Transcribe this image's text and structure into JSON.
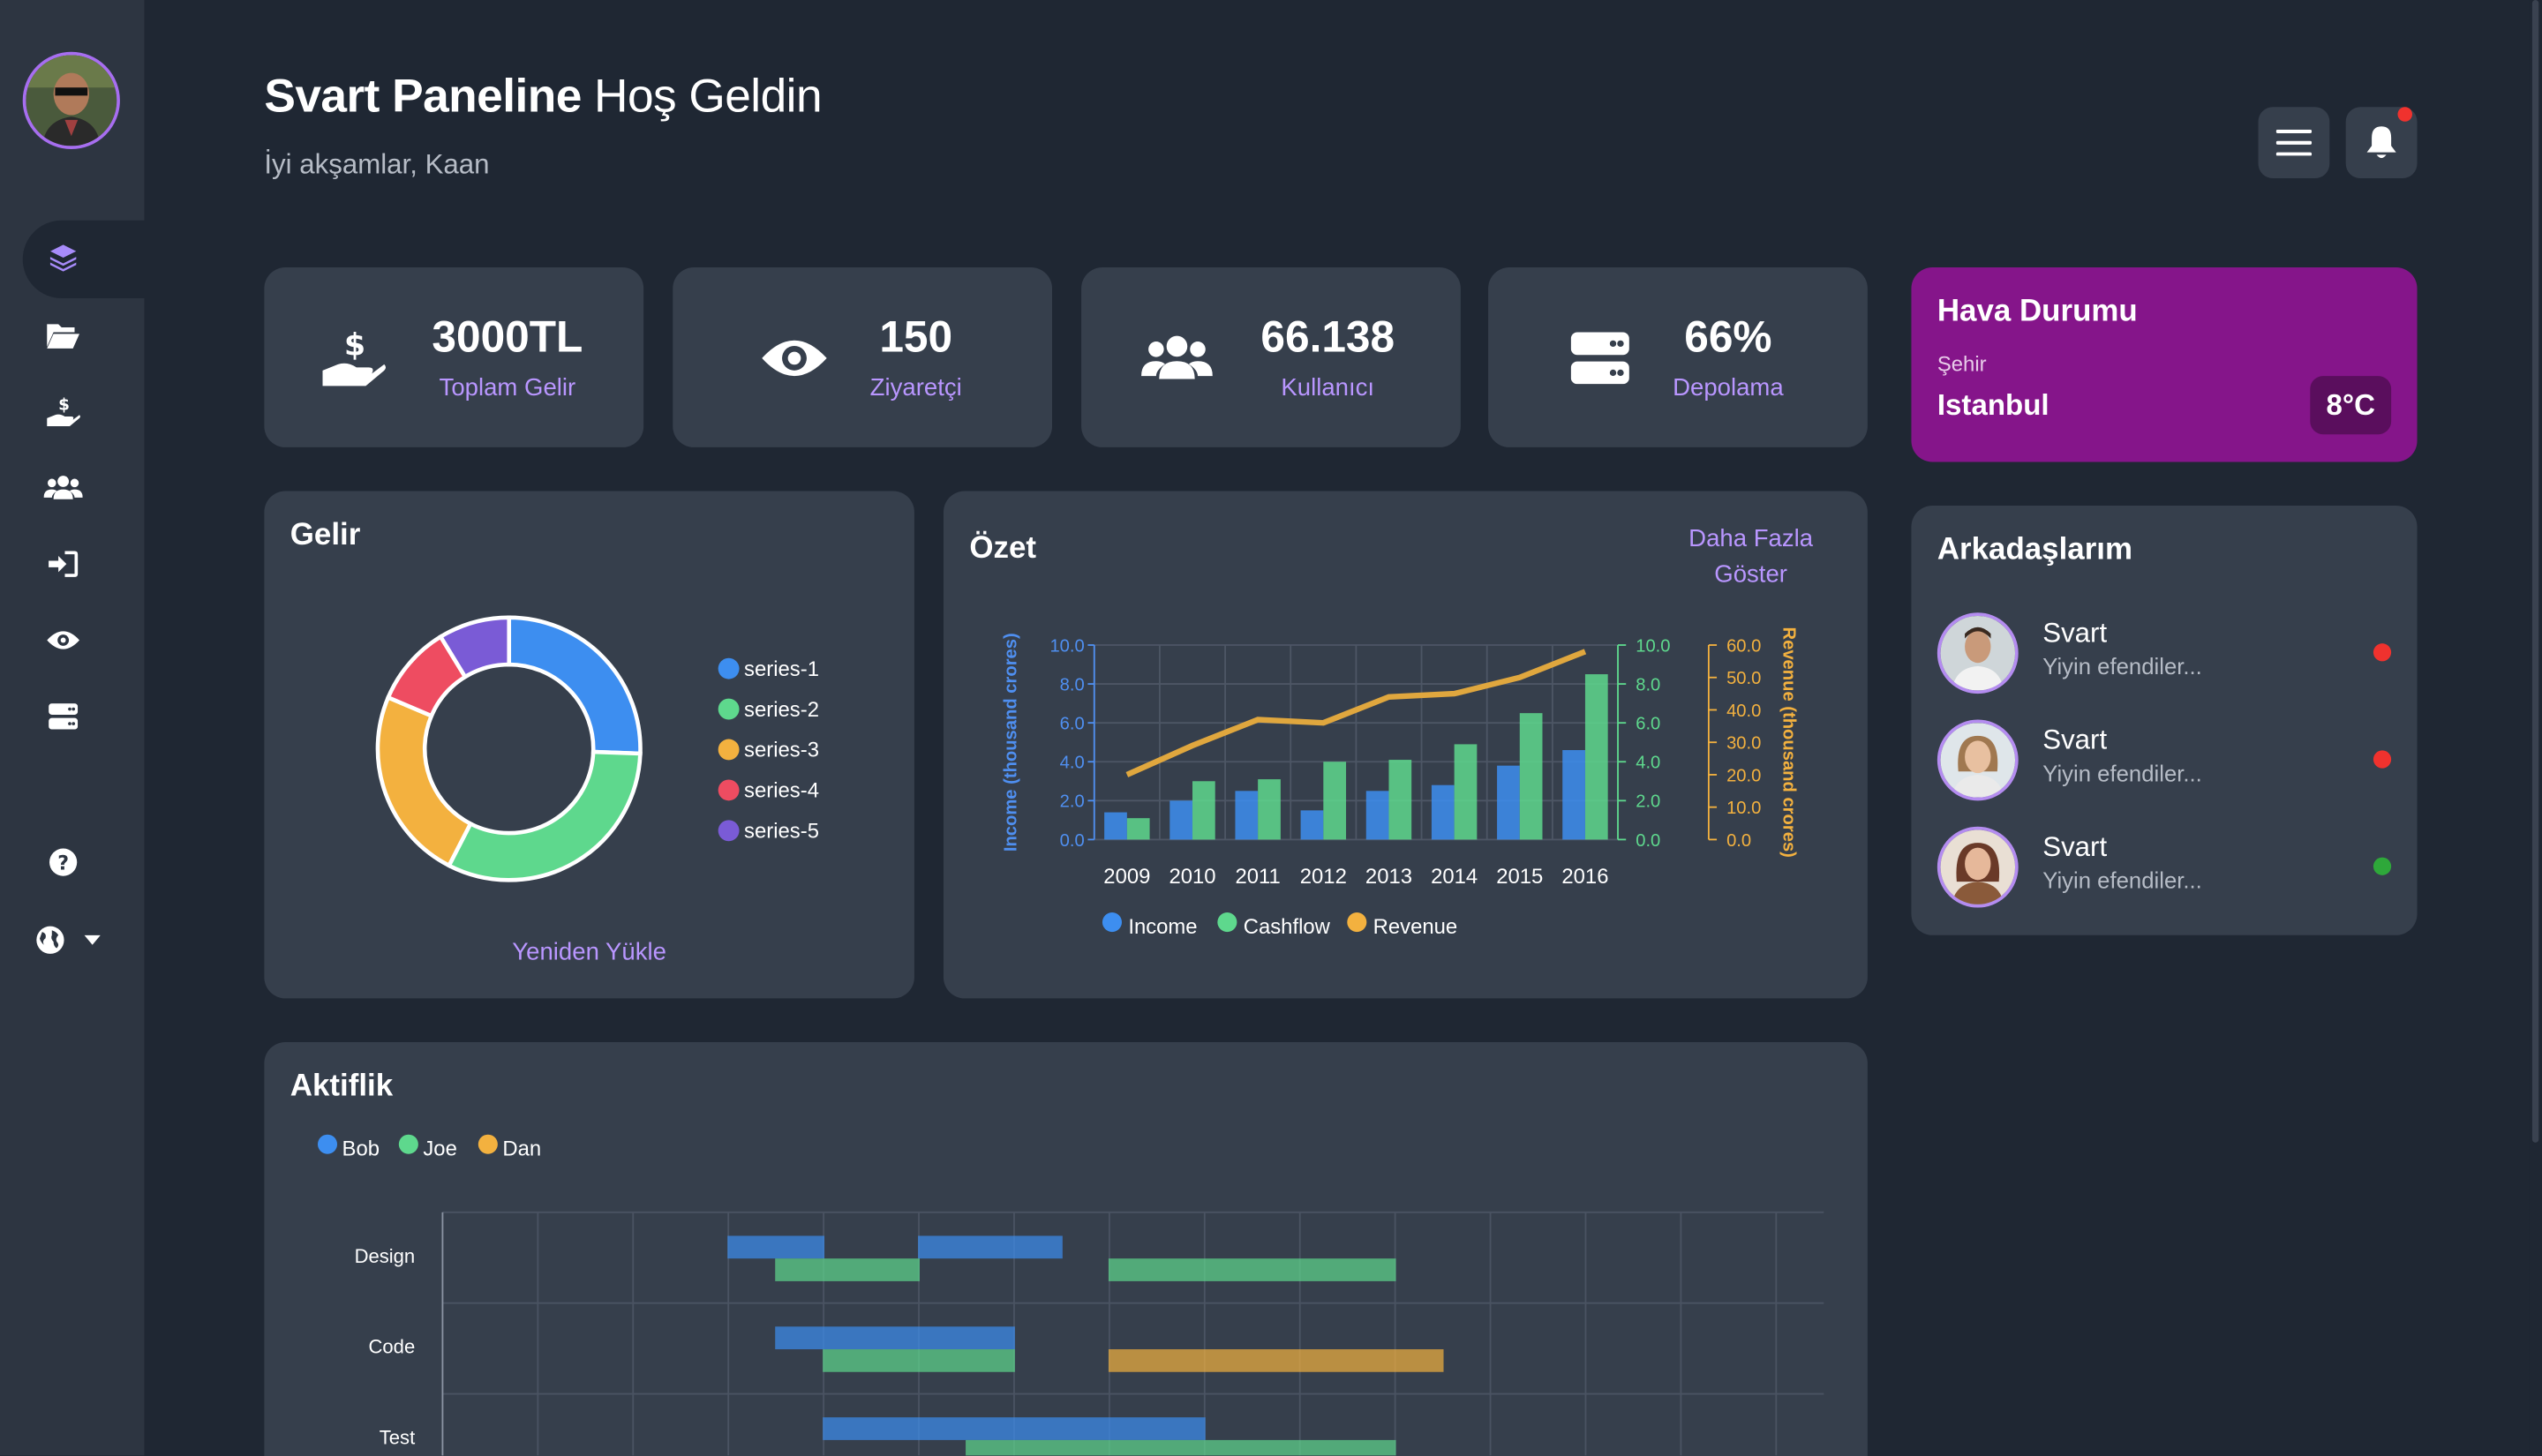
{
  "header": {
    "title_bold": "Svart Paneline",
    "title_rest": "Hoş Geldin",
    "subtitle": "İyi akşamlar, Kaan"
  },
  "stats": [
    {
      "value": "3000TL",
      "label": "Toplam Gelir",
      "icon": "hand-dollar-icon"
    },
    {
      "value": "150",
      "label": "Ziyaretçi",
      "icon": "eye-icon"
    },
    {
      "value": "66.138",
      "label": "Kullanıcı",
      "icon": "users-icon"
    },
    {
      "value": "66%",
      "label": "Depolama",
      "icon": "server-icon"
    }
  ],
  "weather": {
    "title": "Hava Durumu",
    "city_label": "Şehir",
    "city": "Istanbul",
    "temp": "8°C"
  },
  "friends": {
    "title": "Arkadaşlarım",
    "items": [
      {
        "name": "Svart",
        "message": "Yiyin efendiler...",
        "status": "offline",
        "status_color": "#f0322e"
      },
      {
        "name": "Svart",
        "message": "Yiyin efendiler...",
        "status": "offline",
        "status_color": "#f0322e"
      },
      {
        "name": "Svart",
        "message": "Yiyin efendiler...",
        "status": "online",
        "status_color": "#2ea83a"
      }
    ]
  },
  "gelir": {
    "title": "Gelir",
    "reload": "Yeniden Yükle"
  },
  "ozet": {
    "title": "Özet",
    "more_line1": "Daha Fazla",
    "more_line2": "Göster"
  },
  "aktiflik": {
    "title": "Aktiflik"
  },
  "colors": {
    "blue": "#3d8ef0",
    "green": "#5ed88d",
    "orange": "#f3b13f",
    "red": "#ee4c61",
    "purple": "#7a5bd6",
    "accent": "#b996ff",
    "weather_bg": "#85158a"
  },
  "chart_data": [
    {
      "type": "pie",
      "variant": "donut",
      "labels": [
        "series-1",
        "series-2",
        "series-3",
        "series-4",
        "series-5"
      ],
      "values": [
        44,
        55,
        41,
        17,
        15
      ],
      "legend": "right"
    },
    {
      "type": "bar",
      "x": [
        "2009",
        "2010",
        "2011",
        "2012",
        "2013",
        "2014",
        "2015",
        "2016"
      ],
      "series": [
        {
          "name": "Income",
          "type": "bar",
          "values": [
            1.4,
            2.0,
            2.5,
            1.5,
            2.5,
            2.8,
            3.8,
            4.6
          ]
        },
        {
          "name": "Cashflow",
          "type": "bar",
          "values": [
            1.1,
            3.0,
            3.1,
            4.0,
            4.1,
            4.9,
            6.5,
            8.5
          ]
        },
        {
          "name": "Revenue",
          "type": "line",
          "values": [
            20,
            29,
            37,
            36,
            44,
            45,
            50,
            58
          ]
        }
      ],
      "yaxes": [
        {
          "label": "Income (thousand crores)",
          "range": [
            0,
            10
          ],
          "ticks": [
            "0.0",
            "2.0",
            "4.0",
            "6.0",
            "8.0",
            "10.0"
          ]
        },
        {
          "label": "",
          "range": [
            0,
            10
          ],
          "ticks": [
            "0.0",
            "2.0",
            "4.0",
            "6.0",
            "8.0",
            "10.0"
          ]
        },
        {
          "label": "Revenue (thousand crores)",
          "range": [
            0,
            60
          ],
          "ticks": [
            "0.0",
            "10.0",
            "20.0",
            "30.0",
            "40.0",
            "50.0",
            "60.0"
          ]
        }
      ],
      "legend": "bottom",
      "grid": true
    },
    {
      "type": "bar",
      "variant": "timeline",
      "categories": [
        "Design",
        "Code",
        "Test"
      ],
      "series": [
        {
          "name": "Bob",
          "ranges": [
            [
              "Design",
              3.0,
              4.0
            ],
            [
              "Design",
              5.0,
              6.5
            ],
            [
              "Code",
              3.5,
              6.0
            ],
            [
              "Test",
              4.0,
              8.0
            ]
          ]
        },
        {
          "name": "Joe",
          "ranges": [
            [
              "Design",
              3.5,
              5.0
            ],
            [
              "Design",
              7.0,
              10.0
            ],
            [
              "Code",
              4.0,
              6.0
            ],
            [
              "Test",
              5.5,
              10.0
            ]
          ]
        },
        {
          "name": "Dan",
          "ranges": [
            [
              "Code",
              7.0,
              10.5
            ]
          ]
        }
      ],
      "xlim": [
        0,
        14.5
      ],
      "legend": "top-left",
      "grid": true
    }
  ]
}
